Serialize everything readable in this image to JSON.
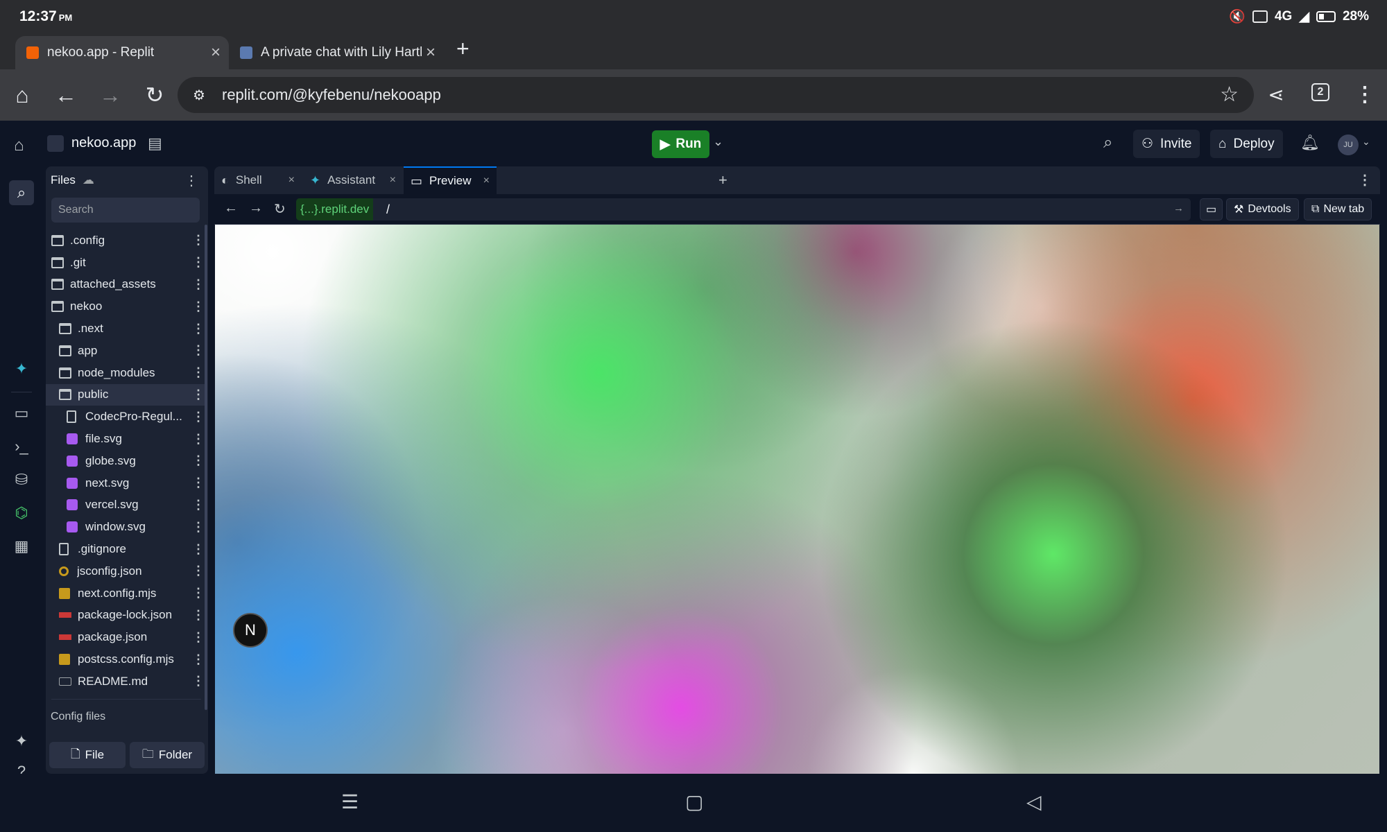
{
  "status_bar": {
    "time": "12:37",
    "ampm": "PM",
    "network": "4G",
    "battery": "28%"
  },
  "browser": {
    "tabs": [
      {
        "title": "nekoo.app - Replit",
        "active": true
      },
      {
        "title": "A private chat with Lily Hartle",
        "active": false
      }
    ],
    "url": "replit.com/@kyfebenu/nekooapp",
    "tab_count": "2"
  },
  "workspace": {
    "repl_name": "nekoo.app",
    "run_label": "Run",
    "invite_label": "Invite",
    "deploy_label": "Deploy",
    "user_initials": "JU"
  },
  "files": {
    "title": "Files",
    "search_placeholder": "Search",
    "tree": [
      {
        "name": ".config",
        "type": "folder",
        "depth": 0
      },
      {
        "name": ".git",
        "type": "folder",
        "depth": 0
      },
      {
        "name": "attached_assets",
        "type": "folder",
        "depth": 0
      },
      {
        "name": "nekoo",
        "type": "folder-open",
        "depth": 0
      },
      {
        "name": ".next",
        "type": "folder",
        "depth": 1
      },
      {
        "name": "app",
        "type": "folder",
        "depth": 1
      },
      {
        "name": "node_modules",
        "type": "folder",
        "depth": 1
      },
      {
        "name": "public",
        "type": "folder-open",
        "depth": 1,
        "selected": true
      },
      {
        "name": "CodecPro-Regul...",
        "type": "file",
        "depth": 2
      },
      {
        "name": "file.svg",
        "type": "svg",
        "depth": 2
      },
      {
        "name": "globe.svg",
        "type": "svg",
        "depth": 2
      },
      {
        "name": "next.svg",
        "type": "svg",
        "depth": 2
      },
      {
        "name": "vercel.svg",
        "type": "svg",
        "depth": 2
      },
      {
        "name": "window.svg",
        "type": "svg",
        "depth": 2
      },
      {
        "name": ".gitignore",
        "type": "file",
        "depth": 1
      },
      {
        "name": "jsconfig.json",
        "type": "jscfg",
        "depth": 1
      },
      {
        "name": "next.config.mjs",
        "type": "js",
        "depth": 1
      },
      {
        "name": "package-lock.json",
        "type": "npm",
        "depth": 1
      },
      {
        "name": "package.json",
        "type": "npm",
        "depth": 1
      },
      {
        "name": "postcss.config.mjs",
        "type": "js",
        "depth": 1
      },
      {
        "name": "README.md",
        "type": "md",
        "depth": 1
      }
    ],
    "config_files_label": "Config files",
    "new_file_label": "File",
    "new_folder_label": "Folder"
  },
  "pane": {
    "tabs": [
      {
        "label": "Shell",
        "icon": "shell-icon"
      },
      {
        "label": "Assistant",
        "icon": "assistant-icon"
      },
      {
        "label": "Preview",
        "icon": "preview-icon",
        "active": true
      }
    ],
    "domain_chip": "{...}.replit.dev",
    "path": "/",
    "devtools_label": "Devtools",
    "new_tab_label": "New tab"
  },
  "preview": {
    "badge": "N"
  },
  "colors": {
    "run_green": "#1a8027",
    "bg": "#0e1525",
    "panel": "#1c2333",
    "accent": "#0079f2"
  }
}
